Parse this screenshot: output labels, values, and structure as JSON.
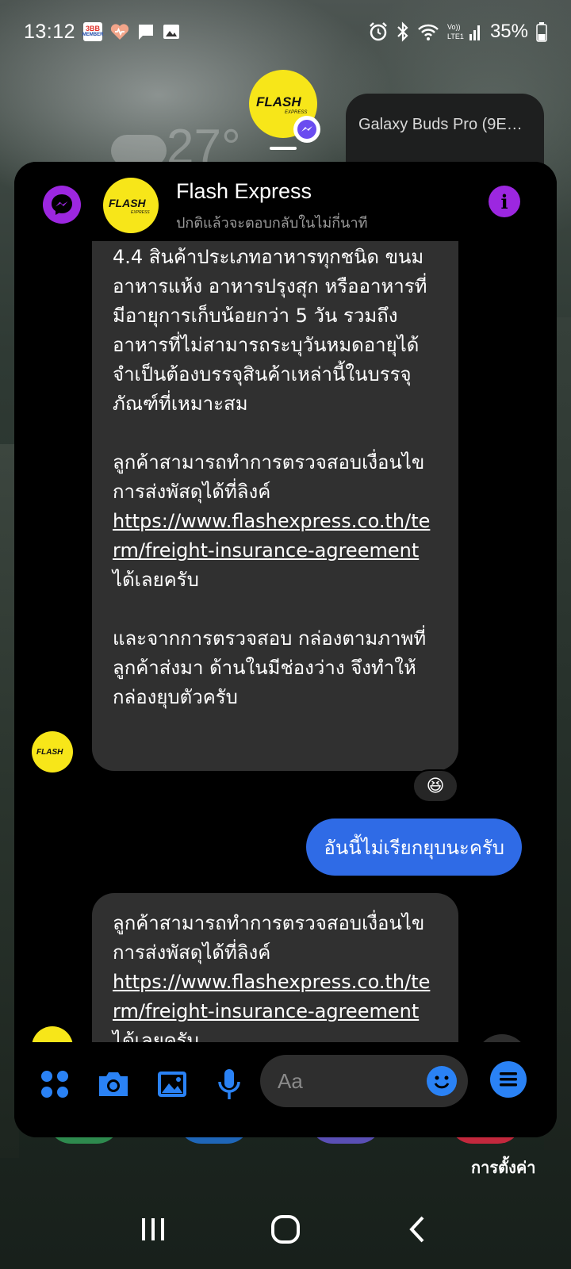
{
  "status_bar": {
    "time": "13:12",
    "battery": "35%",
    "badge_text": "3BB MEMBER"
  },
  "home": {
    "weather_temp": "27°",
    "buds_widget": "Galaxy Buds Pro (9E…",
    "settings_label": "การตั้งค่า"
  },
  "chat": {
    "contact_name": "Flash Express",
    "contact_status": "ปกติแล้วจะตอบกลับในไม่กี่นาที",
    "logo_text": "FLASH",
    "logo_sub": "EXPRESS",
    "messages": [
      {
        "from": "business",
        "para1": "4.4 สินค้าประเภทอาหารทุกชนิด ขนม อาหารแห้ง อาหารปรุงสุก หรืออาหารที่มีอายุการเก็บน้อยกว่า 5 วัน รวมถึงอาหารที่ไม่สามารถระบุวันหมดอายุได้ จำเป็นต้องบรรจุสินค้าเหล่านี้ในบรรจุภัณฑ์ที่เหมาะสม",
        "para2_text": "ลูกค้าสามารถทำการตรวจสอบเงื่อนไขการส่งพัสดุได้ที่ลิงค์",
        "para2_link": "https://www.flashexpress.co.th/term/freight-insurance-agreement",
        "para2_suffix": "ได้เลยครับ",
        "para3": "และจากการตรวจสอบ กล่องตามภาพที่ลูกค้าส่งมา ด้านในมีช่องว่าง จึงทำให้กล่องยุบตัวครับ",
        "reaction": "😆"
      },
      {
        "from": "user",
        "text": "อันนี้ไม่เรียกยุบนะครับ"
      },
      {
        "from": "business",
        "para1_text": "ลูกค้าสามารถทำการตรวจสอบเงื่อนไขการส่งพัสดุได้ที่ลิงค์",
        "para1_link": "https://www.flashexpress.co.th/term/freight-insurance-agreement",
        "para1_suffix": "ได้เลยครับ"
      }
    ],
    "composer_placeholder": "Aa"
  },
  "colors": {
    "accent_purple": "#9c27e0",
    "accent_blue": "#2a82f5",
    "outgoing_bubble": "#2f6be6",
    "incoming_bubble": "#303030",
    "flash_yellow": "#f7e619"
  }
}
